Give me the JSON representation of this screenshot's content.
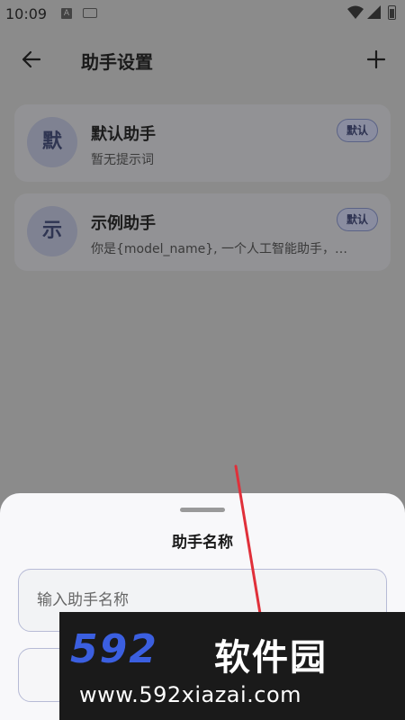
{
  "status_bar": {
    "time": "10:09",
    "icons": [
      "text-a-icon",
      "keyboard-icon",
      "wifi-icon",
      "signal-icon",
      "battery-icon"
    ]
  },
  "header": {
    "title": "助手设置",
    "back_icon": "arrow-left-icon",
    "add_icon": "plus-icon"
  },
  "assistants": [
    {
      "avatar": "默",
      "name": "默认助手",
      "description": "暂无提示词",
      "badge": "默认"
    },
    {
      "avatar": "示",
      "name": "示例助手",
      "description": "你是{model_name}, 一个人工智能助手，…",
      "badge": "默认"
    }
  ],
  "sheet": {
    "title": "助手名称",
    "name_placeholder": "输入助手名称"
  },
  "watermark": {
    "logo_digits": "592",
    "logo_text": "软件园",
    "url": "www.592xiazai.com"
  },
  "colors": {
    "accent": "#3b5fe0",
    "annotation_line": "#e0303a",
    "badge_border": "#5b6386"
  }
}
